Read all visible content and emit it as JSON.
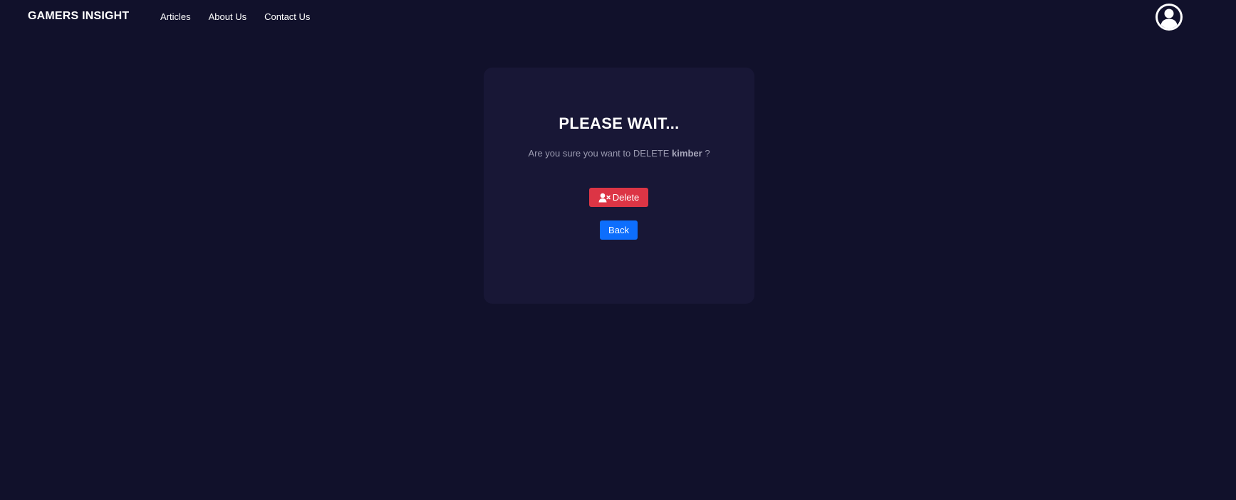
{
  "navbar": {
    "brand": "GAMERS INSIGHT",
    "links": [
      "Articles",
      "About Us",
      "Contact Us"
    ],
    "avatar_icon": "user-circle-icon"
  },
  "dialog": {
    "title": "PLEASE WAIT...",
    "message_prefix": "Are you sure you want to DELETE",
    "target_name": "kimber",
    "message_suffix": "?",
    "delete_label": "Delete",
    "delete_icon": "user-x-icon",
    "back_label": "Back"
  },
  "colors": {
    "background": "#11112b",
    "card": "#181736",
    "delete": "#dc3545",
    "back": "#0d6efd"
  }
}
